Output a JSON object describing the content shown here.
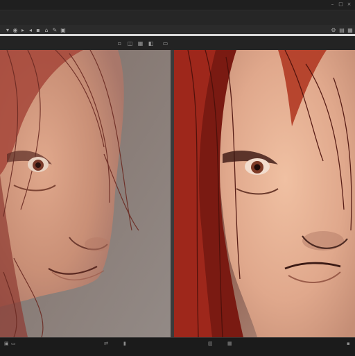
{
  "window": {
    "title": "",
    "controls": [
      {
        "name": "minimize-icon",
        "glyph": "–"
      },
      {
        "name": "maximize-icon",
        "glyph": "□"
      },
      {
        "name": "close-icon",
        "glyph": "×"
      }
    ]
  },
  "toolbar": {
    "left_icons": [
      {
        "name": "tool-icon-1",
        "glyph": "▾"
      },
      {
        "name": "tool-icon-2",
        "glyph": "◉"
      },
      {
        "name": "tool-icon-3",
        "glyph": "▸"
      },
      {
        "name": "tool-icon-4",
        "glyph": "◂"
      },
      {
        "name": "tool-icon-5",
        "glyph": "▪"
      },
      {
        "name": "tool-icon-6",
        "glyph": "⌂"
      },
      {
        "name": "tool-icon-7",
        "glyph": "✎"
      },
      {
        "name": "tool-icon-8",
        "glyph": "▣"
      }
    ],
    "right_icons": [
      {
        "name": "settings-icon",
        "glyph": "⚙"
      },
      {
        "name": "panel-icon",
        "glyph": "▤"
      },
      {
        "name": "more-icon",
        "glyph": "▦"
      }
    ]
  },
  "viewbar": {
    "icons": [
      {
        "name": "view-single-icon",
        "glyph": "▫"
      },
      {
        "name": "view-split-icon",
        "glyph": "◫"
      },
      {
        "name": "view-grid-icon",
        "glyph": "▦"
      },
      {
        "name": "view-compare-icon",
        "glyph": "◧"
      },
      {
        "name": "view-zoom-icon",
        "glyph": "▭"
      }
    ]
  },
  "statusbar": {
    "left": [
      {
        "name": "frame-icon",
        "glyph": "▣"
      },
      {
        "name": "fit-icon",
        "glyph": "▭"
      }
    ],
    "center_left": [
      {
        "name": "swap-icon",
        "glyph": "⇄"
      },
      {
        "name": "flip-icon",
        "glyph": "▮"
      }
    ],
    "center_right": [
      {
        "name": "crop-icon",
        "glyph": "▥"
      },
      {
        "name": "grid-icon",
        "glyph": "▦"
      }
    ],
    "right": [
      {
        "name": "info-icon",
        "glyph": "▪"
      }
    ]
  },
  "colors": {
    "accent": "#d9d9d9",
    "hair_dark": "#6b0f0f",
    "hair_red": "#a0261b",
    "skin": "#d9a78a"
  }
}
